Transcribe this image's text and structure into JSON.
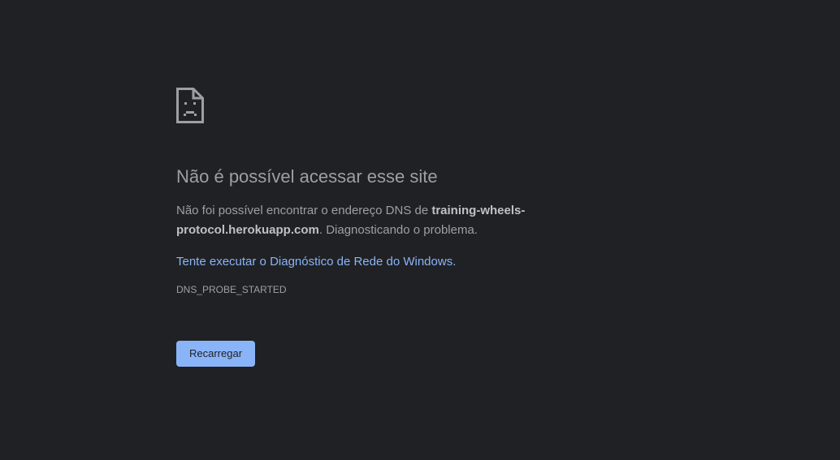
{
  "error_page": {
    "icon": "sad-document-icon",
    "title": "Não é possível acessar esse site",
    "description": {
      "prefix": "Não foi possível encontrar o endereço DNS de ",
      "host": "training-wheels-protocol.herokuapp.com",
      "suffix": ". Diagnosticando o problema."
    },
    "suggestion_link": "Tente executar o Diagnóstico de Rede do Windows.",
    "error_code": "DNS_PROBE_STARTED",
    "reload_label": "Recarregar"
  },
  "colors": {
    "background": "#202124",
    "text": "#9aa0a6",
    "link": "#8ab4f8",
    "button": "#8ab4f8"
  }
}
